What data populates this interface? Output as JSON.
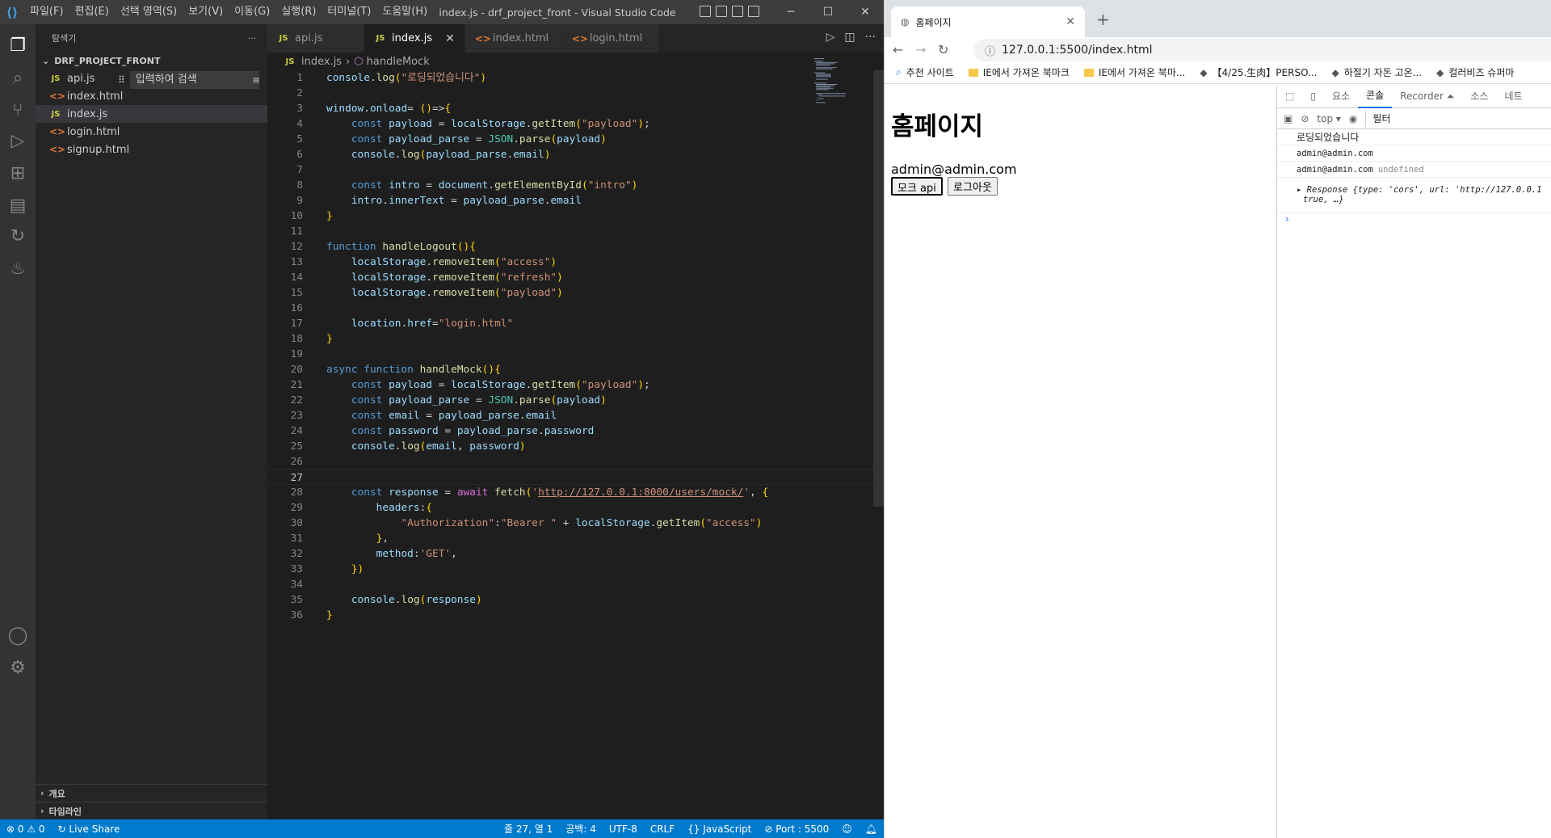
{
  "vscode": {
    "menu": [
      "파일(F)",
      "편집(E)",
      "선택 영역(S)",
      "보기(V)",
      "이동(G)",
      "실행(R)",
      "터미널(T)",
      "도움말(H)"
    ],
    "window_title": "index.js - drf_project_front - Visual Studio Code",
    "explorer": {
      "header": "탐색기",
      "project": "DRF_PROJECT_FRONT",
      "files": [
        {
          "name": "api.js",
          "type": "js"
        },
        {
          "name": "index.html",
          "type": "html"
        },
        {
          "name": "index.js",
          "type": "js",
          "selected": true
        },
        {
          "name": "login.html",
          "type": "html"
        },
        {
          "name": "signup.html",
          "type": "html"
        }
      ],
      "find_placeholder": "입력하여 검색",
      "sections": [
        "개요",
        "타임라인"
      ]
    },
    "tabs": [
      {
        "name": "api.js",
        "type": "js"
      },
      {
        "name": "index.js",
        "type": "js",
        "active": true
      },
      {
        "name": "index.html",
        "type": "html"
      },
      {
        "name": "login.html",
        "type": "html"
      }
    ],
    "breadcrumb": {
      "file": "index.js",
      "symbol": "handleMock"
    },
    "code_lines": [
      "console.log(\"로딩되었습니다\")",
      "",
      "window.onload= ()=>{",
      "    const payload = localStorage.getItem(\"payload\");",
      "    const payload_parse = JSON.parse(payload)",
      "    console.log(payload_parse.email)",
      "",
      "    const intro = document.getElementById(\"intro\")",
      "    intro.innerText = payload_parse.email",
      "}",
      "",
      "function handleLogout(){",
      "    localStorage.removeItem(\"access\")",
      "    localStorage.removeItem(\"refresh\")",
      "    localStorage.removeItem(\"payload\")",
      "",
      "    location.href=\"login.html\"",
      "}",
      "",
      "async function handleMock(){",
      "    const payload = localStorage.getItem(\"payload\");",
      "    const payload_parse = JSON.parse(payload)",
      "    const email = payload_parse.email",
      "    const password = payload_parse.password",
      "    console.log(email, password)",
      "",
      "",
      "    const response = await fetch('http://127.0.0.1:8000/users/mock/', {",
      "        headers:{",
      "            \"Authorization\":\"Bearer \" + localStorage.getItem(\"access\")",
      "        },",
      "        method:'GET',",
      "    })",
      "",
      "    console.log(response)",
      "}"
    ],
    "current_line": 27,
    "status": {
      "problems": "⊗ 0 ⚠ 0",
      "live_share": "Live Share",
      "position": "줄 27, 열 1",
      "spaces": "공백: 4",
      "encoding": "UTF-8",
      "eol": "CRLF",
      "language": "JavaScript",
      "port": "Port : 5500"
    }
  },
  "chrome": {
    "tab_title": "홈페이지",
    "url": "127.0.0.1:5500/index.html",
    "bookmarks": [
      "추천 사이트",
      "IE에서 가져온 북마크",
      "IE에서 가져온 북마...",
      "【4/25.生肉】PERSO...",
      "하절기 자돈 고온...",
      "컬러비즈 슈퍼마"
    ],
    "page": {
      "heading": "홈페이지",
      "intro": "admin@admin.com",
      "mock_button": "모크 api",
      "logout_button": "로그아웃"
    },
    "devtools": {
      "tabs": [
        "요소",
        "콘솔",
        "Recorder ⏶",
        "소스",
        "네트"
      ],
      "context": "top",
      "filter_placeholder": "필터",
      "console": [
        {
          "text": "로딩되었습니다"
        },
        {
          "text": "admin@admin.com"
        },
        {
          "text": "admin@admin.com",
          "extra": "undefined"
        }
      ],
      "response_text": "▸ Response {type: 'cors', url: 'http://127.0.0.1",
      "response_tail": "true, …}"
    }
  }
}
